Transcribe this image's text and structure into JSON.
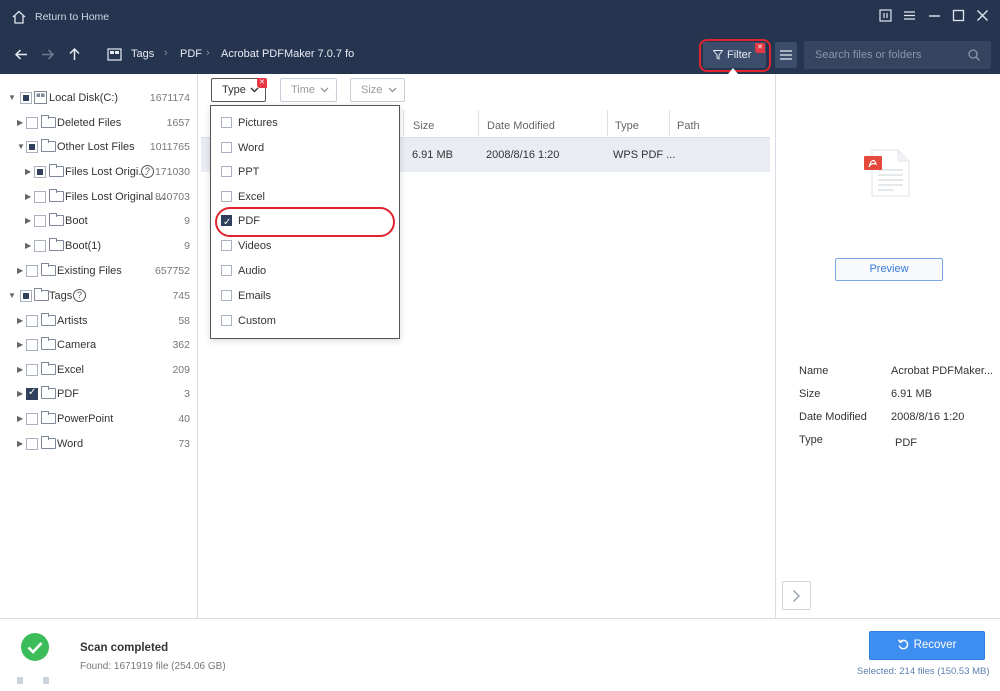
{
  "titlebar": {
    "return_label": "Return to Home"
  },
  "toolbar": {
    "breadcrumb": [
      "Tags",
      "PDF",
      "Acrobat PDFMaker 7.0.7 fo"
    ],
    "filter_label": "Filter",
    "search_placeholder": "Search files or folders"
  },
  "tree": {
    "items": [
      {
        "label": "Local Disk(C:)",
        "count": "1671174"
      },
      {
        "label": "Deleted Files",
        "count": "1657"
      },
      {
        "label": "Other Lost Files",
        "count": "1011765"
      },
      {
        "label": "Files Lost Origi...",
        "count": "171030"
      },
      {
        "label": "Files Lost Original ...",
        "count": "840703"
      },
      {
        "label": "Boot",
        "count": "9"
      },
      {
        "label": "Boot(1)",
        "count": "9"
      },
      {
        "label": "Existing Files",
        "count": "657752"
      },
      {
        "label": "Tags",
        "count": "745"
      },
      {
        "label": "Artists",
        "count": "58"
      },
      {
        "label": "Camera",
        "count": "362"
      },
      {
        "label": "Excel",
        "count": "209"
      },
      {
        "label": "PDF",
        "count": "3"
      },
      {
        "label": "PowerPoint",
        "count": "40"
      },
      {
        "label": "Word",
        "count": "73"
      }
    ]
  },
  "filters": {
    "type": "Type",
    "time": "Time",
    "size": "Size"
  },
  "columns": {
    "size": "Size",
    "date": "Date Modified",
    "type": "Type",
    "path": "Path"
  },
  "row": {
    "size": "6.91 MB",
    "date": "2008/8/16 1:20",
    "type": "WPS PDF ..."
  },
  "type_menu": {
    "options": [
      {
        "label": "Pictures",
        "checked": false
      },
      {
        "label": "Word",
        "checked": false
      },
      {
        "label": "PPT",
        "checked": false
      },
      {
        "label": "Excel",
        "checked": false
      },
      {
        "label": "PDF",
        "checked": true
      },
      {
        "label": "Videos",
        "checked": false
      },
      {
        "label": "Audio",
        "checked": false
      },
      {
        "label": "Emails",
        "checked": false
      },
      {
        "label": "Custom",
        "checked": false
      }
    ]
  },
  "preview": {
    "button_label": "Preview",
    "meta": [
      {
        "key": "Name",
        "value": "Acrobat PDFMaker..."
      },
      {
        "key": "Size",
        "value": "6.91 MB"
      },
      {
        "key": "Date Modified",
        "value": "2008/8/16 1:20"
      },
      {
        "key": "Type",
        "value": "PDF"
      }
    ]
  },
  "footer": {
    "status_title": "Scan completed",
    "status_detail": "Found: 1671919 file (254.06 GB)",
    "recover_label": "Recover",
    "selected_text": "Selected: 214 files (150.53 MB)"
  },
  "colors": {
    "titlebar_bg": "#26354f",
    "accent": "#3d8ef0",
    "highlight_ring": "#e0242f",
    "success": "#3cbd5a"
  }
}
